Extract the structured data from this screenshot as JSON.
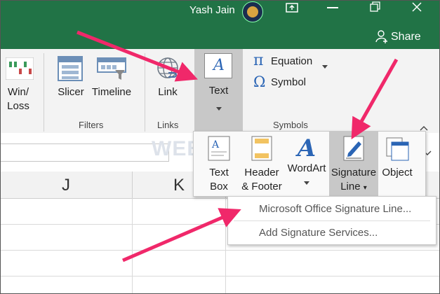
{
  "titlebar": {
    "user_name": "Yash Jain",
    "share_label": "Share"
  },
  "ribbon": {
    "sparkline_label_line1": "Win/",
    "sparkline_label_line2": "Loss",
    "slicer_label": "Slicer",
    "timeline_label": "Timeline",
    "link_label": "Link",
    "text_label": "Text",
    "equation_label": "Equation",
    "symbol_label": "Symbol",
    "groups": {
      "filters": "Filters",
      "links": "Links",
      "symbols": "Symbols"
    }
  },
  "grid": {
    "columns": [
      "J",
      "K"
    ]
  },
  "text_dropdown": {
    "textbox_line1": "Text",
    "textbox_line2": "Box",
    "header_line1": "Header",
    "header_line2": "& Footer",
    "wordart": "WordArt",
    "signature_line1": "Signature",
    "signature_line2": "Line",
    "object": "Object"
  },
  "signature_menu": {
    "items": [
      "Microsoft Office Signature Line...",
      "Add Signature Services..."
    ]
  },
  "watermark": "WEBXBOX",
  "colors": {
    "excel_green": "#217346",
    "arrow_pink": "#f0286a",
    "accent_blue": "#2b65b5"
  }
}
